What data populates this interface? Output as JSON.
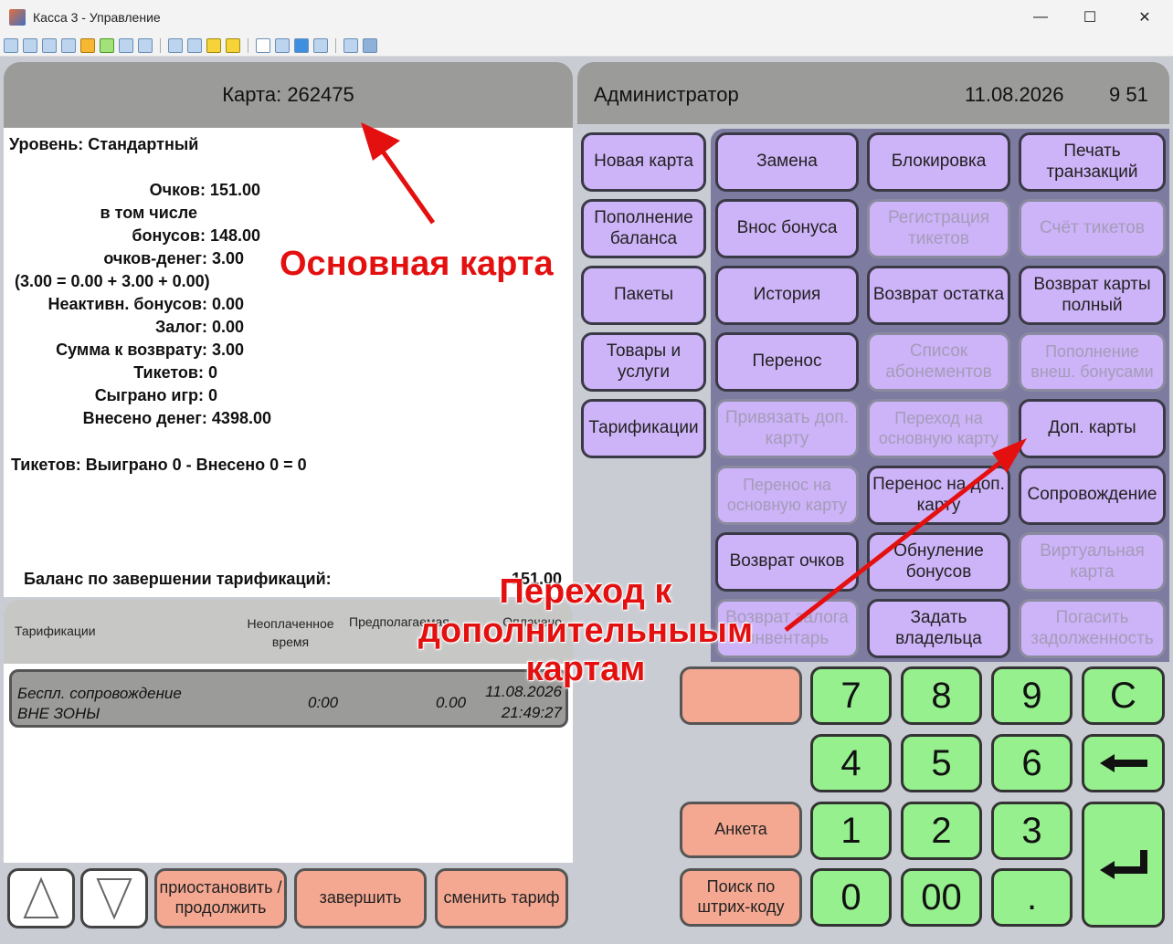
{
  "window": {
    "title": "Касса 3 - Управление",
    "minimize": "—",
    "maximize": "☐",
    "close": "✕"
  },
  "card": {
    "header": "Карта: 262475"
  },
  "info": {
    "level": "Уровень: Стандартный",
    "points": "Очков: 151.00",
    "including": "в том числе",
    "bonuses": "бонусов: 148.00",
    "money_points": "очков-денег: 3.00",
    "formula": "(3.00 = 0.00 + 3.00 + 0.00)",
    "inactive_bonuses": "Неактивн. бонусов: 0.00",
    "deposit": "Залог: 0.00",
    "refund_sum": "Сумма к возврату: 3.00",
    "tickets": "Тикетов: 0",
    "games_played": "Сыграно игр: 0",
    "money_in": "Внесено денег: 4398.00",
    "tickets_line": "Тикетов: Выиграно 0 - Внесено 0 = 0",
    "balance_label": "Баланс по завершении тарификаций:",
    "balance_value": "151.00"
  },
  "tariff_table": {
    "col1": "Тарификации",
    "col2": "Неоплаченное время",
    "col3": "Предполагаемая",
    "col4": "Оплачено",
    "row": {
      "name1": "Беспл. сопровождение",
      "name2": "ВНЕ ЗОНЫ",
      "unpaid": "0:00",
      "expected": "0.00",
      "date": "11.08.2026",
      "time": "21:49:27"
    }
  },
  "bottom_buttons": {
    "pause": "приостановить / продолжить",
    "finish": "завершить",
    "change": "сменить тариф"
  },
  "header_right": {
    "user": "Администратор",
    "date": "11.08.2026",
    "time": "9 51"
  },
  "left_buttons": [
    "Новая карта",
    "Пополнение баланса",
    "Пакеты",
    "Товары и услуги",
    "Тарификации"
  ],
  "grid_buttons": [
    [
      "Замена",
      "Блокировка",
      "Печать транзакций"
    ],
    [
      "Внос бонуса",
      "Регистрация тикетов",
      "Счёт тикетов"
    ],
    [
      "История",
      "Возврат остатка",
      "Возврат карты полный"
    ],
    [
      "Перенос",
      "Список абонементов",
      "Пополнение внеш. бонусами"
    ],
    [
      "Привязать доп. карту",
      "Переход на основную карту",
      "Доп. карты"
    ],
    [
      "Перенос на основную карту",
      "Перенос на доп. карту",
      "Сопровождение"
    ],
    [
      "Возврат очков",
      "Обнуление бонусов",
      "Виртуальная карта"
    ],
    [
      "Возврат залога инвентарь",
      "Задать владельца",
      "Погасить задолженность"
    ]
  ],
  "side_buttons": {
    "questionnaire": "Анкета",
    "barcode": "Поиск по штрих-коду"
  },
  "keypad": [
    "7",
    "8",
    "9",
    "C",
    "4",
    "5",
    "6",
    "1",
    "2",
    "3",
    "0",
    "00",
    "."
  ],
  "annotations": {
    "main_card": "Основная карта",
    "go_extra": "Переход к дополнительныым картам"
  },
  "colors": {
    "accent_red": "#e41010",
    "purple": "#cdb3f7",
    "green": "#96f08e",
    "orange": "#f4a892"
  }
}
